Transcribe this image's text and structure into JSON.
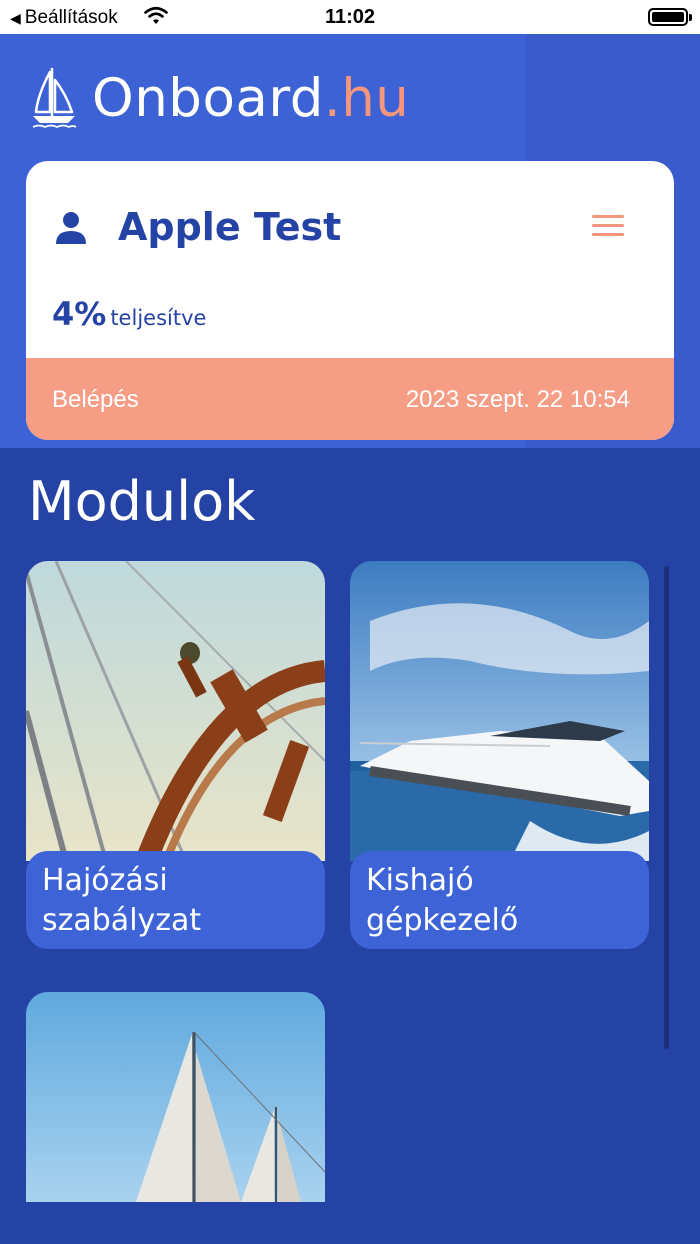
{
  "status_bar": {
    "back_label": "Beállítások",
    "time": "11:02"
  },
  "header": {
    "logo_main": "Onboard",
    "logo_accent": ".hu",
    "accent_color": "#f6967d",
    "background_color": "#3c62d5"
  },
  "profile": {
    "name": "Apple Test",
    "progress_value": "4%",
    "progress_label": "teljesítve",
    "login_label": "Belépés",
    "login_date": "2023 szept. 22 10:54"
  },
  "modules": {
    "title": "Modulok",
    "items": [
      {
        "line1": "Hajózási",
        "line2": "szabályzat",
        "image": "ship-wheel-photo"
      },
      {
        "line1": "Kishajó",
        "line2": "gépkezelő",
        "image": "motor-yacht-photo"
      },
      {
        "line1": "",
        "line2": "",
        "image": "sailboat-photo"
      }
    ]
  }
}
